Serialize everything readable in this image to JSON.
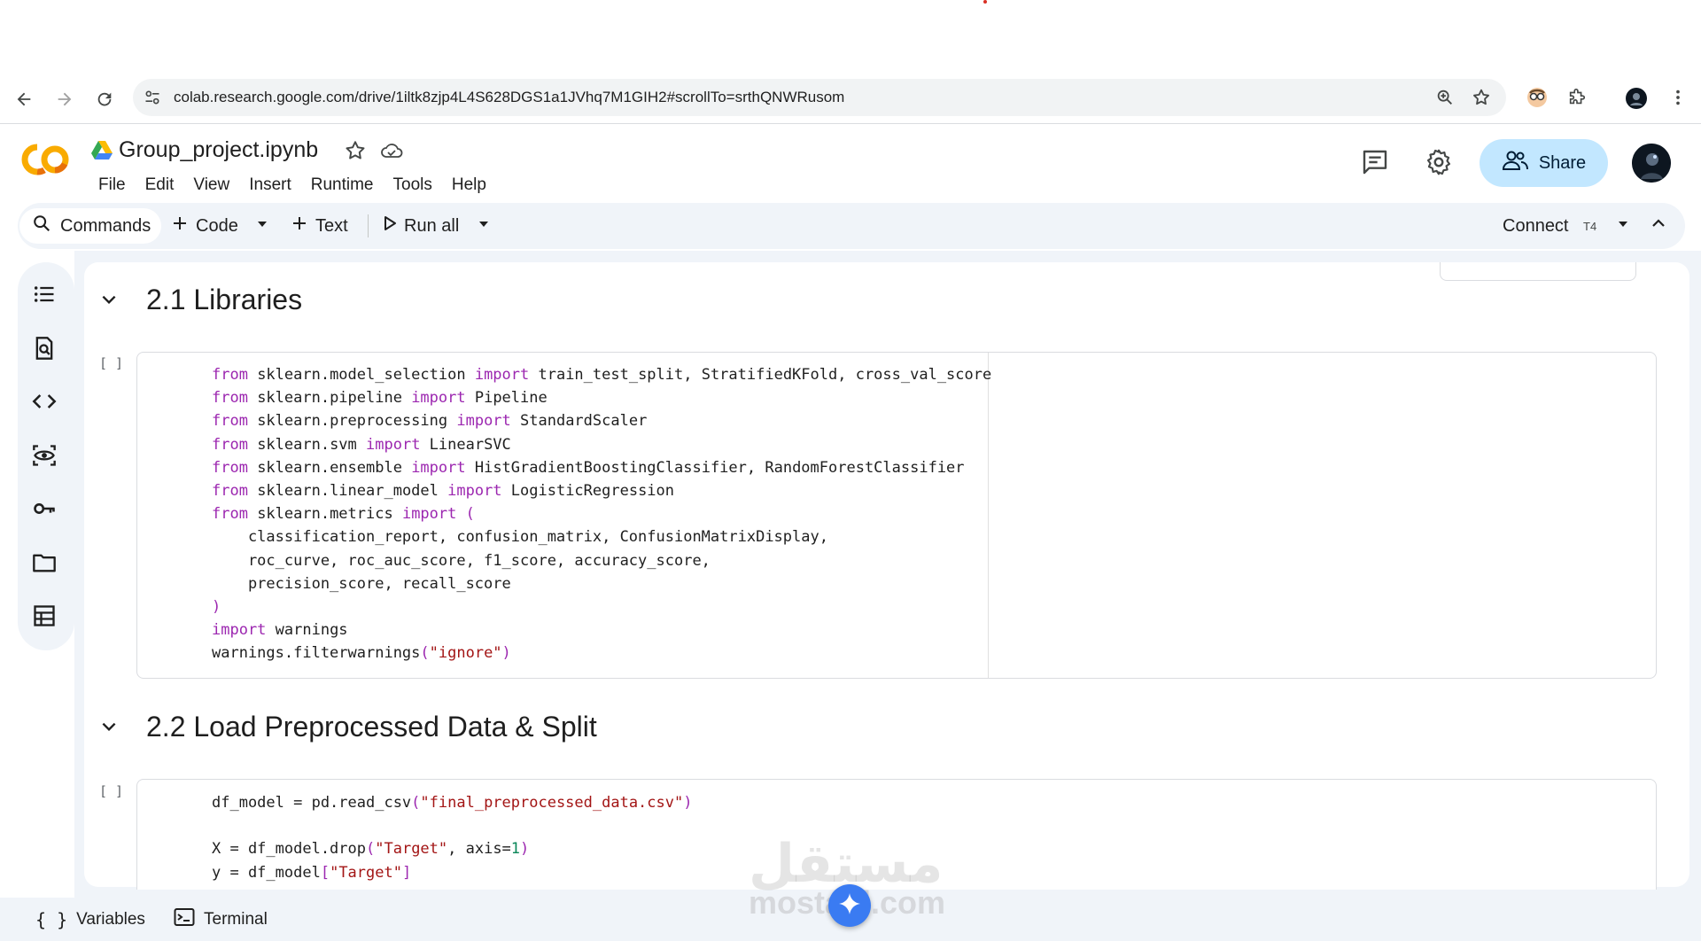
{
  "browser": {
    "url": "colab.research.google.com/drive/1iltk8zjp4L4S628DGS1a1JVhq7M1GIH2#scrollTo=srthQNWRusom"
  },
  "header": {
    "notebook_title": "Group_project.ipynb",
    "share_label": "Share",
    "menu": [
      "File",
      "Edit",
      "View",
      "Insert",
      "Runtime",
      "Tools",
      "Help"
    ]
  },
  "toolbar": {
    "commands_label": "Commands",
    "code_label": "Code",
    "text_label": "Text",
    "run_all_label": "Run all",
    "connect_label": "Connect",
    "runtime_type": "T4"
  },
  "sections": [
    {
      "title": "2.1 Libraries",
      "run_indicator": "[ ]",
      "code": [
        [
          {
            "t": "from",
            "c": "kw"
          },
          {
            "t": " sklearn.model_selection "
          },
          {
            "t": "import",
            "c": "kw"
          },
          {
            "t": " train_test_split, StratifiedKFold, cross_val_score"
          }
        ],
        [
          {
            "t": "from",
            "c": "kw"
          },
          {
            "t": " sklearn.pipeline "
          },
          {
            "t": "import",
            "c": "kw"
          },
          {
            "t": " Pipeline"
          }
        ],
        [
          {
            "t": "from",
            "c": "kw"
          },
          {
            "t": " sklearn.preprocessing "
          },
          {
            "t": "import",
            "c": "kw"
          },
          {
            "t": " StandardScaler"
          }
        ],
        [
          {
            "t": "from",
            "c": "kw"
          },
          {
            "t": " sklearn.svm "
          },
          {
            "t": "import",
            "c": "kw"
          },
          {
            "t": " LinearSVC"
          }
        ],
        [
          {
            "t": "from",
            "c": "kw"
          },
          {
            "t": " sklearn.ensemble "
          },
          {
            "t": "import",
            "c": "kw"
          },
          {
            "t": " HistGradientBoostingClassifier, RandomForestClassifier"
          }
        ],
        [
          {
            "t": "from",
            "c": "kw"
          },
          {
            "t": " sklearn.linear_model "
          },
          {
            "t": "import",
            "c": "kw"
          },
          {
            "t": " LogisticRegression"
          }
        ],
        [
          {
            "t": "from",
            "c": "kw"
          },
          {
            "t": " sklearn.metrics "
          },
          {
            "t": "import",
            "c": "kw"
          },
          {
            "t": " "
          },
          {
            "t": "(",
            "c": "kw"
          }
        ],
        [
          {
            "t": "    classification_report, confusion_matrix, ConfusionMatrixDisplay,"
          }
        ],
        [
          {
            "t": "    roc_curve, roc_auc_score, f1_score, accuracy_score,"
          }
        ],
        [
          {
            "t": "    precision_score, recall_score"
          }
        ],
        [
          {
            "t": ")",
            "c": "kw"
          }
        ],
        [
          {
            "t": "import",
            "c": "kw"
          },
          {
            "t": " warnings"
          }
        ],
        [
          {
            "t": "warnings.filterwarnings"
          },
          {
            "t": "(",
            "c": "kw"
          },
          {
            "t": "\"ignore\"",
            "c": "str"
          },
          {
            "t": ")",
            "c": "kw"
          }
        ]
      ]
    },
    {
      "title": "2.2 Load Preprocessed Data & Split",
      "run_indicator": "[ ]",
      "code": [
        [
          {
            "t": "df_model = pd.read_csv"
          },
          {
            "t": "(",
            "c": "kw"
          },
          {
            "t": "\"final_preprocessed_data.csv\"",
            "c": "str"
          },
          {
            "t": ")",
            "c": "kw"
          }
        ],
        [
          {
            "t": ""
          }
        ],
        [
          {
            "t": "X = df_model.drop"
          },
          {
            "t": "(",
            "c": "kw"
          },
          {
            "t": "\"Target\"",
            "c": "str"
          },
          {
            "t": ", axis="
          },
          {
            "t": "1",
            "c": "num"
          },
          {
            "t": ")",
            "c": "kw"
          }
        ],
        [
          {
            "t": "y = df_model"
          },
          {
            "t": "[",
            "c": "kw"
          },
          {
            "t": "\"Target\"",
            "c": "str"
          },
          {
            "t": "]",
            "c": "kw"
          }
        ]
      ]
    }
  ],
  "statusbar": {
    "variables_label": "Variables",
    "terminal_label": "Terminal"
  },
  "watermark": {
    "arabic": "مستقل",
    "latin": "mostaql.com"
  }
}
